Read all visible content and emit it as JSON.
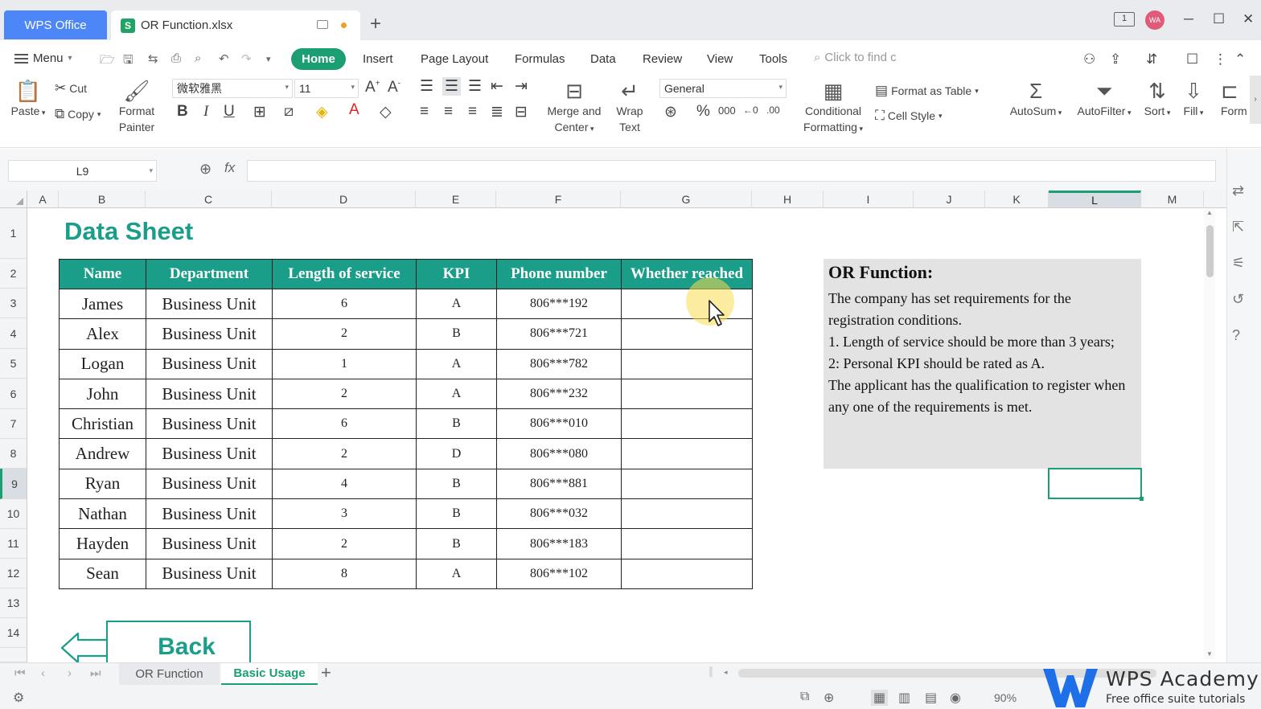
{
  "titlebar": {
    "app_tab": "WPS Office",
    "file_tab": "OR Function.xlsx",
    "file_icon": "S",
    "new_tab": "+",
    "avatar": "WA",
    "win_min": "─",
    "win_max": "☐",
    "win_close": "✕",
    "window_count": "1"
  },
  "menubar": {
    "menu_label": "Menu",
    "tabs": [
      "Home",
      "Insert",
      "Page Layout",
      "Formulas",
      "Data",
      "Review",
      "View",
      "Tools"
    ],
    "search_placeholder": "Click to find c"
  },
  "ribbon": {
    "paste": "Paste",
    "cut": "Cut",
    "copy": "Copy",
    "format_painter_1": "Format",
    "format_painter_2": "Painter",
    "font_name": "微软雅黑",
    "font_size": "11",
    "bold": "B",
    "italic": "I",
    "underline": "U",
    "merge_1": "Merge and",
    "merge_2": "Center",
    "wrap_1": "Wrap",
    "wrap_2": "Text",
    "number_format": "General",
    "cond_fmt_1": "Conditional",
    "cond_fmt_2": "Formatting",
    "format_as_table": "Format as Table",
    "cell_style": "Cell Style",
    "autosum": "AutoSum",
    "autofilter": "AutoFilter",
    "sort": "Sort",
    "fill": "Fill",
    "format": "Form"
  },
  "formula_bar": {
    "cell_ref": "L9",
    "fx": "fx",
    "formula": ""
  },
  "sheet": {
    "columns": [
      "A",
      "B",
      "C",
      "D",
      "E",
      "F",
      "G",
      "H",
      "I",
      "J",
      "K",
      "L",
      "M"
    ],
    "selected_column": "L",
    "rows": [
      "1",
      "2",
      "3",
      "4",
      "5",
      "6",
      "7",
      "8",
      "9",
      "10",
      "11",
      "12",
      "13",
      "14"
    ],
    "selected_row": "9",
    "title": "Data Sheet",
    "table": {
      "headers": [
        "Name",
        "Department",
        "Length of service",
        "KPI",
        "Phone number",
        "Whether reached"
      ],
      "rows": [
        [
          "James",
          "Business Unit",
          "6",
          "A",
          "806***192",
          ""
        ],
        [
          "Alex",
          "Business Unit",
          "2",
          "B",
          "806***721",
          ""
        ],
        [
          "Logan",
          "Business Unit",
          "1",
          "A",
          "806***782",
          ""
        ],
        [
          "John",
          "Business Unit",
          "2",
          "A",
          "806***232",
          ""
        ],
        [
          "Christian",
          "Business Unit",
          "6",
          "B",
          "806***010",
          ""
        ],
        [
          "Andrew",
          "Business Unit",
          "2",
          "D",
          "806***080",
          ""
        ],
        [
          "Ryan",
          "Business Unit",
          "4",
          "B",
          "806***881",
          ""
        ],
        [
          "Nathan",
          "Business Unit",
          "3",
          "B",
          "806***032",
          ""
        ],
        [
          "Hayden",
          "Business Unit",
          "2",
          "B",
          "806***183",
          ""
        ],
        [
          "Sean",
          "Business Unit",
          "8",
          "A",
          "806***102",
          ""
        ]
      ]
    },
    "note": {
      "title": "OR Function:",
      "lines": [
        "The company has set requirements for the registration conditions.",
        "1. Length of service should be more than 3 years;",
        "2: Personal KPI should be rated as A.",
        "The applicant has the qualification to register when any one of the requirements is met."
      ]
    },
    "back_button": "Back"
  },
  "sheet_tabs": {
    "tabs": [
      "OR Function",
      "Basic Usage"
    ],
    "active": "Basic Usage",
    "add": "+"
  },
  "statusbar": {
    "zoom": "90%",
    "brand": "WPS Academy",
    "brand_sub": "Free office suite tutorials"
  },
  "colors": {
    "accent_green": "#1a9e72",
    "table_header": "#1a9e8a",
    "wps_blue": "#4d86f6",
    "note_bg": "#e3e3e3"
  }
}
